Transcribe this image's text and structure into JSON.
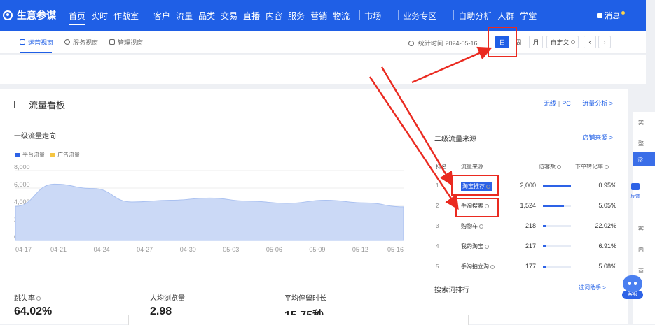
{
  "header": {
    "logo": "生意参谋",
    "nav": [
      "首页",
      "实时",
      "作战室",
      "客户",
      "流量",
      "品类",
      "交易",
      "直播",
      "内容",
      "服务",
      "营销",
      "物流",
      "市场",
      "业务专区",
      "自助分析",
      "人群",
      "学堂"
    ],
    "message": "消息"
  },
  "subbar": {
    "tabs": [
      "运营视窗",
      "服务视窗",
      "管理视窗"
    ],
    "stat_time": "统计时间 2024-05-16",
    "date_buttons": [
      "日",
      "周",
      "月",
      "自定义"
    ]
  },
  "panel": {
    "title": "流量看板",
    "right_links": [
      "无线",
      "PC",
      "流量分析 >"
    ],
    "chart_title": "一级流量走向",
    "legend": [
      "平台流量",
      "广告流量"
    ],
    "right_title": "二级流量来源",
    "right_link": "店铺来源 >",
    "table_headers": [
      "排名",
      "流量来源",
      "访客数",
      "下单转化率"
    ],
    "rows": [
      {
        "rank": "1",
        "source": "淘宝推荐",
        "visitors": "2,000",
        "bar": 1.0,
        "rate": "0.95%"
      },
      {
        "rank": "2",
        "source": "手淘搜索",
        "visitors": "1,524",
        "bar": 0.76,
        "rate": "5.05%"
      },
      {
        "rank": "3",
        "source": "购物车",
        "visitors": "218",
        "bar": 0.11,
        "rate": "22.02%"
      },
      {
        "rank": "4",
        "source": "我的淘宝",
        "visitors": "217",
        "bar": 0.11,
        "rate": "6.91%"
      },
      {
        "rank": "5",
        "source": "手淘拍立淘",
        "visitors": "177",
        "bar": 0.09,
        "rate": "5.08%"
      }
    ],
    "search_title": "搜索词排行",
    "search_link": "选词助手 >",
    "kpis": [
      {
        "label": "跳失率",
        "value": "64.02%"
      },
      {
        "label": "人均浏览量",
        "value": "2.98"
      },
      {
        "label": "平均停留时长",
        "value": "15.75秒"
      }
    ]
  },
  "side": {
    "items": [
      "实",
      "整",
      "诊",
      "客",
      "内",
      "商"
    ],
    "feedback": "反馈",
    "bot": "客服"
  },
  "chart_data": {
    "type": "area",
    "x": [
      "04-17",
      "04-21",
      "04-24",
      "04-27",
      "04-30",
      "05-03",
      "05-06",
      "05-09",
      "05-12",
      "05-16"
    ],
    "ytick_labels": [
      "0",
      "2,000",
      "4,000",
      "6,000",
      "8,000"
    ],
    "ylim": [
      0,
      8000
    ],
    "series": [
      {
        "name": "平台流量",
        "color": "#cbd9f6",
        "values": [
          3900,
          6450,
          5950,
          4400,
          4600,
          4850,
          4500,
          4250,
          4600,
          4300,
          3850
        ]
      },
      {
        "name": "广告流量",
        "color": "#f5c542",
        "values": [
          0,
          0,
          0,
          0,
          0,
          0,
          0,
          0,
          0,
          0,
          0
        ]
      }
    ]
  },
  "colors": {
    "brand": "#1f5fe6",
    "annotation": "#ea2a20"
  }
}
